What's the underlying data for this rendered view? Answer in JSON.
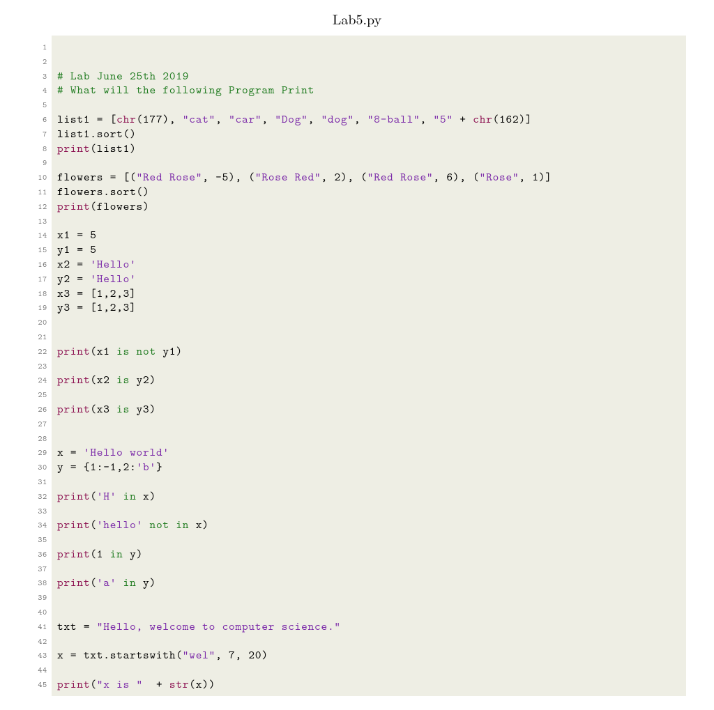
{
  "title": "Lab5.py",
  "line_count": 45,
  "lines": [
    {
      "tokens": []
    },
    {
      "tokens": []
    },
    {
      "tokens": [
        {
          "t": "# Lab June 25th 2019",
          "c": "tk-comment"
        }
      ]
    },
    {
      "tokens": [
        {
          "t": "# What will the following Program Print",
          "c": "tk-comment"
        }
      ]
    },
    {
      "tokens": []
    },
    {
      "tokens": [
        {
          "t": "list1 = ["
        },
        {
          "t": "chr",
          "c": "tk-builtin"
        },
        {
          "t": "(177), "
        },
        {
          "t": "\"cat\"",
          "c": "tk-string"
        },
        {
          "t": ", "
        },
        {
          "t": "\"car\"",
          "c": "tk-string"
        },
        {
          "t": ", "
        },
        {
          "t": "\"Dog\"",
          "c": "tk-string"
        },
        {
          "t": ", "
        },
        {
          "t": "\"dog\"",
          "c": "tk-string"
        },
        {
          "t": ", "
        },
        {
          "t": "\"8-ball\"",
          "c": "tk-string"
        },
        {
          "t": ", "
        },
        {
          "t": "\"5\"",
          "c": "tk-string"
        },
        {
          "t": " + "
        },
        {
          "t": "chr",
          "c": "tk-builtin"
        },
        {
          "t": "(162)]"
        }
      ]
    },
    {
      "tokens": [
        {
          "t": "list1.sort()"
        }
      ]
    },
    {
      "tokens": [
        {
          "t": "print",
          "c": "tk-builtin"
        },
        {
          "t": "(list1)"
        }
      ]
    },
    {
      "tokens": []
    },
    {
      "tokens": [
        {
          "t": "flowers = [("
        },
        {
          "t": "\"Red Rose\"",
          "c": "tk-string"
        },
        {
          "t": ", -5), ("
        },
        {
          "t": "\"Rose Red\"",
          "c": "tk-string"
        },
        {
          "t": ", 2), ("
        },
        {
          "t": "\"Red Rose\"",
          "c": "tk-string"
        },
        {
          "t": ", 6), ("
        },
        {
          "t": "\"Rose\"",
          "c": "tk-string"
        },
        {
          "t": ", 1)]"
        }
      ]
    },
    {
      "tokens": [
        {
          "t": "flowers.sort()"
        }
      ]
    },
    {
      "tokens": [
        {
          "t": "print",
          "c": "tk-builtin"
        },
        {
          "t": "(flowers)"
        }
      ]
    },
    {
      "tokens": []
    },
    {
      "tokens": [
        {
          "t": "x1 = 5"
        }
      ]
    },
    {
      "tokens": [
        {
          "t": "y1 = 5"
        }
      ]
    },
    {
      "tokens": [
        {
          "t": "x2 = "
        },
        {
          "t": "'Hello'",
          "c": "tk-string"
        }
      ]
    },
    {
      "tokens": [
        {
          "t": "y2 = "
        },
        {
          "t": "'Hello'",
          "c": "tk-string"
        }
      ]
    },
    {
      "tokens": [
        {
          "t": "x3 = [1,2,3]"
        }
      ]
    },
    {
      "tokens": [
        {
          "t": "y3 = [1,2,3]"
        }
      ]
    },
    {
      "tokens": []
    },
    {
      "tokens": []
    },
    {
      "tokens": [
        {
          "t": "print",
          "c": "tk-builtin"
        },
        {
          "t": "(x1 "
        },
        {
          "t": "is not",
          "c": "tk-keyword"
        },
        {
          "t": " y1)"
        }
      ]
    },
    {
      "tokens": []
    },
    {
      "tokens": [
        {
          "t": "print",
          "c": "tk-builtin"
        },
        {
          "t": "(x2 "
        },
        {
          "t": "is",
          "c": "tk-keyword"
        },
        {
          "t": " y2)"
        }
      ]
    },
    {
      "tokens": []
    },
    {
      "tokens": [
        {
          "t": "print",
          "c": "tk-builtin"
        },
        {
          "t": "(x3 "
        },
        {
          "t": "is",
          "c": "tk-keyword"
        },
        {
          "t": " y3)"
        }
      ]
    },
    {
      "tokens": []
    },
    {
      "tokens": []
    },
    {
      "tokens": [
        {
          "t": "x = "
        },
        {
          "t": "'Hello world'",
          "c": "tk-string"
        }
      ]
    },
    {
      "tokens": [
        {
          "t": "y = {1:-1,2:"
        },
        {
          "t": "'b'",
          "c": "tk-string"
        },
        {
          "t": "}"
        }
      ]
    },
    {
      "tokens": []
    },
    {
      "tokens": [
        {
          "t": "print",
          "c": "tk-builtin"
        },
        {
          "t": "("
        },
        {
          "t": "'H'",
          "c": "tk-string"
        },
        {
          "t": " "
        },
        {
          "t": "in",
          "c": "tk-keyword"
        },
        {
          "t": " x)"
        }
      ]
    },
    {
      "tokens": []
    },
    {
      "tokens": [
        {
          "t": "print",
          "c": "tk-builtin"
        },
        {
          "t": "("
        },
        {
          "t": "'hello'",
          "c": "tk-string"
        },
        {
          "t": " "
        },
        {
          "t": "not in",
          "c": "tk-keyword"
        },
        {
          "t": " x)"
        }
      ]
    },
    {
      "tokens": []
    },
    {
      "tokens": [
        {
          "t": "print",
          "c": "tk-builtin"
        },
        {
          "t": "(1 "
        },
        {
          "t": "in",
          "c": "tk-keyword"
        },
        {
          "t": " y)"
        }
      ]
    },
    {
      "tokens": []
    },
    {
      "tokens": [
        {
          "t": "print",
          "c": "tk-builtin"
        },
        {
          "t": "("
        },
        {
          "t": "'a'",
          "c": "tk-string"
        },
        {
          "t": " "
        },
        {
          "t": "in",
          "c": "tk-keyword"
        },
        {
          "t": " y)"
        }
      ]
    },
    {
      "tokens": []
    },
    {
      "tokens": []
    },
    {
      "tokens": [
        {
          "t": "txt = "
        },
        {
          "t": "\"Hello, welcome to computer science.\"",
          "c": "tk-string"
        }
      ]
    },
    {
      "tokens": []
    },
    {
      "tokens": [
        {
          "t": "x = txt.startswith("
        },
        {
          "t": "\"wel\"",
          "c": "tk-string"
        },
        {
          "t": ", 7, 20)"
        }
      ]
    },
    {
      "tokens": []
    },
    {
      "tokens": [
        {
          "t": "print",
          "c": "tk-builtin"
        },
        {
          "t": "("
        },
        {
          "t": "\"x is \"",
          "c": "tk-string"
        },
        {
          "t": "  + "
        },
        {
          "t": "str",
          "c": "tk-builtin"
        },
        {
          "t": "(x))"
        }
      ]
    }
  ]
}
